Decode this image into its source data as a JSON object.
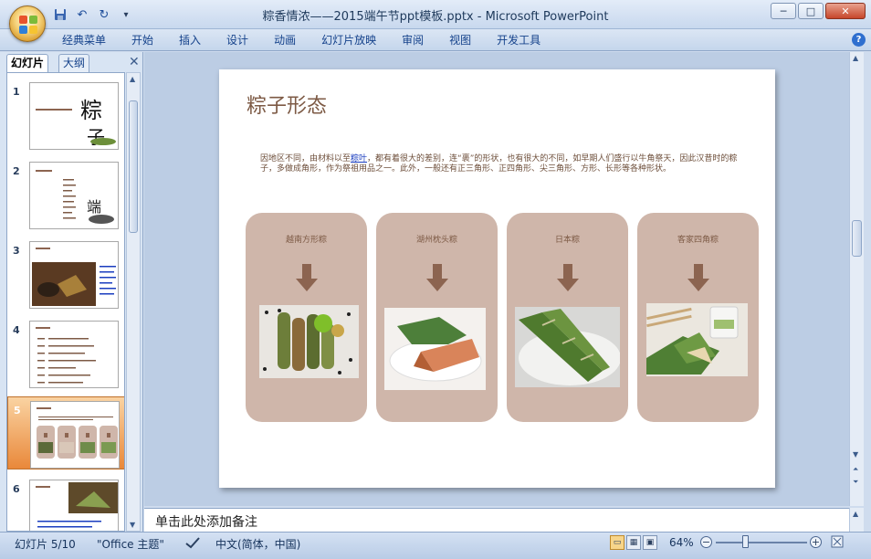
{
  "window": {
    "title": "粽香情浓——2015端午节ppt模板.pptx - Microsoft PowerPoint",
    "minimize": "─",
    "maximize": "□",
    "close": "✕"
  },
  "quick_access": {
    "save_icon": "save-icon",
    "undo_icon": "undo-icon",
    "redo_icon": "redo-icon",
    "customize": "▾"
  },
  "ribbon": {
    "tabs": [
      "经典菜单",
      "开始",
      "插入",
      "设计",
      "动画",
      "幻灯片放映",
      "审阅",
      "视图",
      "开发工具"
    ],
    "help": "?"
  },
  "left_pane": {
    "tab_slides": "幻灯片",
    "tab_outline": "大纲",
    "close": "✕",
    "slide_numbers": [
      "1",
      "2",
      "3",
      "4",
      "5",
      "6"
    ],
    "selected_index": 5
  },
  "slide": {
    "title": "粽子形态",
    "body_part1": "因地区不同，由材料以至",
    "body_link": "粽叶",
    "body_part2": "，都有着很大的差别，连“裹”的形状，也有很大的不同，如早期人们盛行以牛角祭天，因此汉昔时的粽子，多做成角形，作为祭祖用品之一。此外，一般还有正三角形、正四角形、尖三角形、方形、长形等各种形状。",
    "cards": [
      {
        "title": "越南方形粽"
      },
      {
        "title": "湖州枕头粽"
      },
      {
        "title": "日本粽"
      },
      {
        "title": "客家四角粽"
      }
    ]
  },
  "notes": {
    "placeholder": "单击此处添加备注"
  },
  "status": {
    "slide_info": "幻灯片 5/10",
    "theme": "\"Office 主题\"",
    "language": "中文(简体，中国)",
    "zoom": "64%",
    "zoom_minus": "−",
    "zoom_plus": "+"
  },
  "colors": {
    "card_bg": "#cfb6aa",
    "slide_title": "#7d5a45",
    "arrow": "#8c6450",
    "selected_thumb": "#e9883a"
  }
}
